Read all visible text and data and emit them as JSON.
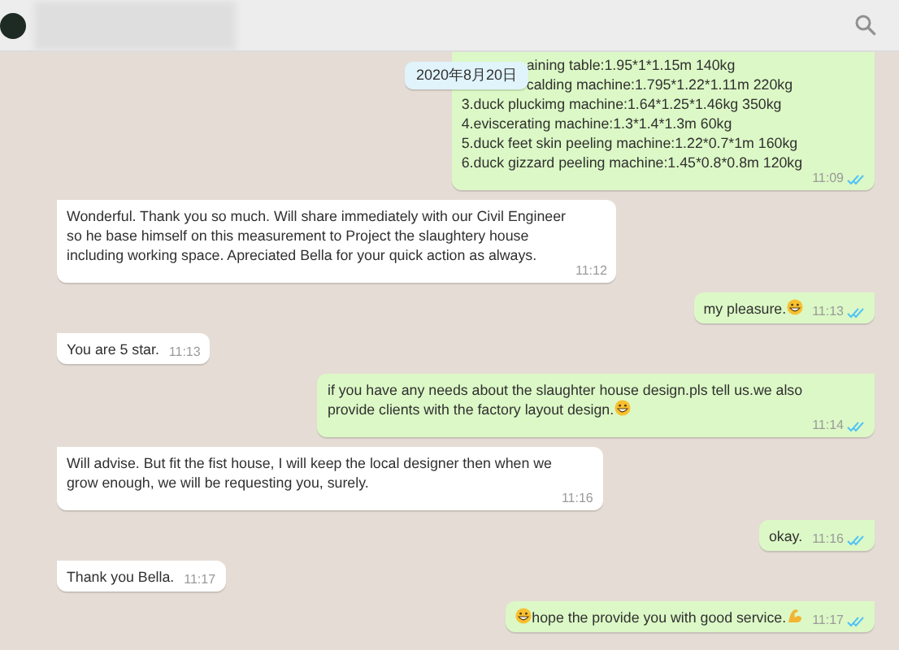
{
  "header": {
    "search": true
  },
  "date_chip": "2020年8月20日",
  "messages": [
    {
      "kind": "outgoing",
      "lines": [
        "aining table:1.95*1*1.15m 140kg",
        "calding machine:1.795*1.22*1.11m 220kg",
        "3.duck pluckimg machine:1.64*1.25*1.46kg 350kg",
        "4.eviscerating machine:1.3*1.4*1.3m 60kg",
        "5.duck feet skin peeling machine:1.22*0.7*1m 160kg",
        "6.duck gizzard peeling machine:1.45*0.8*0.8m 120kg"
      ],
      "time": "11:09",
      "read": true
    },
    {
      "kind": "incoming",
      "lines": [
        "Wonderful. Thank you so much. Will share immediately with our Civil Engineer",
        "so he base himself on this measurement to Project the slaughtery house",
        "including working space. Apreciated Bella for your quick action as always."
      ],
      "time": "11:12"
    },
    {
      "kind": "outgoing",
      "lines": [
        "my pleasure."
      ],
      "grin_after": true,
      "time": "11:13",
      "read": true
    },
    {
      "kind": "incoming",
      "lines": [
        "You are 5 star."
      ],
      "time": "11:13"
    },
    {
      "kind": "outgoing",
      "lines": [
        "if you have any needs about the slaughter house design.pls tell us.we also",
        "provide clients with the factory layout design."
      ],
      "grin_after": true,
      "time": "11:14",
      "read": true
    },
    {
      "kind": "incoming",
      "lines": [
        "Will advise. But fit the fist house, I will keep the local designer then when we",
        "grow enough,  we will be requesting you, surely."
      ],
      "time": "11:16"
    },
    {
      "kind": "outgoing",
      "lines": [
        "okay."
      ],
      "time": "11:16",
      "read": true
    },
    {
      "kind": "incoming",
      "lines": [
        "Thank you Bella."
      ],
      "time": "11:17"
    },
    {
      "kind": "outgoing",
      "lines": [
        "hope the provide you with good service."
      ],
      "grin_before": true,
      "flex_after": true,
      "time": "11:17",
      "read": true
    }
  ]
}
